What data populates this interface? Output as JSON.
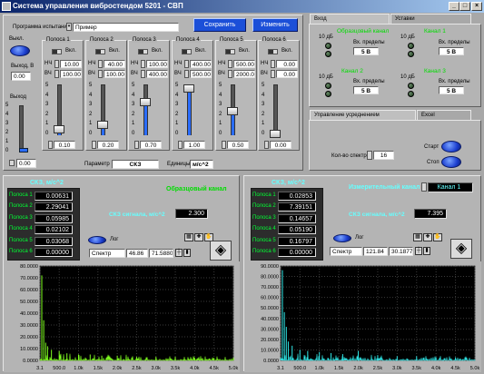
{
  "window": {
    "title": "Система управления вибростендом 5201 - СВП",
    "min": "_",
    "max": "□",
    "close": "×"
  },
  "top": {
    "program_label": "Программа испытаний",
    "program_value": "Пример",
    "save_label": "Сохранить",
    "change_label": "Изменить",
    "power_label": "Выкл.",
    "output_v_label": "Выход, В",
    "output_v_value": "0.00",
    "output_label": "Выход",
    "output_value": "0.00",
    "output_scale": [
      "5",
      "4",
      "3",
      "2",
      "1",
      "0"
    ],
    "param_label": "Параметр",
    "param_value": "СКЗ",
    "units_label": "Единицы",
    "units_value": "м/с^2"
  },
  "bands": [
    {
      "title": "Полоса 1",
      "toggle_label": "Вкл.",
      "hf_label": "НЧ",
      "hf_value": "10.00",
      "lf_label": "ВЧ",
      "lf_value": "100.00",
      "value": "0.10",
      "level": 0.1
    },
    {
      "title": "Полоса 2",
      "toggle_label": "Вкл.",
      "hf_label": "НЧ",
      "hf_value": "40.00",
      "lf_label": "ВЧ",
      "lf_value": "100.00",
      "value": "0.20",
      "level": 0.2
    },
    {
      "title": "Полоса 3",
      "toggle_label": "Вкл.",
      "hf_label": "НЧ",
      "hf_value": "100.00",
      "lf_label": "ВЧ",
      "lf_value": "400.00",
      "value": "0.70",
      "level": 0.7
    },
    {
      "title": "Полоса 4",
      "toggle_label": "Вкл.",
      "hf_label": "НЧ",
      "hf_value": "400.00",
      "lf_label": "ВЧ",
      "lf_value": "500.00",
      "value": "1.00",
      "level": 1.0
    },
    {
      "title": "Полоса 5",
      "toggle_label": "Вкл.",
      "hf_label": "НЧ",
      "hf_value": "500.00",
      "lf_label": "ВЧ",
      "lf_value": "2000.00",
      "value": "0.50",
      "level": 0.5
    },
    {
      "title": "Полоса 6",
      "toggle_label": "Вкл.",
      "hf_label": "НЧ",
      "hf_value": "0.00",
      "lf_label": "ВЧ",
      "lf_value": "0.00",
      "value": "0.00",
      "level": 0.0
    }
  ],
  "band_scale": [
    "5",
    "4",
    "3",
    "2",
    "1",
    "0"
  ],
  "inputs_panel": {
    "tabs": [
      "Вход",
      "Уставки"
    ],
    "reference_channel": "Образцовый канал",
    "channels": [
      {
        "title": "Канал 1",
        "db_label": "10 дБ",
        "range_label": "Вх. пределы",
        "range_value": "5 В"
      },
      {
        "title": "Канал 2",
        "db_label": "10 дБ",
        "range_label": "Вх. пределы",
        "range_value": "5 В"
      },
      {
        "title": "Канал 3",
        "db_label": "10 дБ",
        "range_label": "Вх. пределы",
        "range_value": "5 В"
      }
    ],
    "ref_db_label": "10 дБ",
    "ref_range_label": "Вх. пределы",
    "ref_range_value": "5 В"
  },
  "averaging": {
    "tabs": [
      "Управление усреднением",
      "Excel"
    ],
    "spectra_label": "Кол-во спектров",
    "spectra_value": "16",
    "start_label": "Старт",
    "stop_label": "Стоп"
  },
  "left_channel": {
    "header": "СКЗ, м/с^2",
    "title": "Образцовый канал",
    "band_labels": [
      "Полоса 1",
      "Полоса 2",
      "Полоса 3",
      "Полоса 4",
      "Полоса 5",
      "Полоса 6"
    ],
    "band_values": [
      "0.00631",
      "2.29041",
      "0.05985",
      "0.02102",
      "0.03068",
      "0.00000"
    ],
    "sum_label": "СКЗ сигнала, м/с^2",
    "sum_value": "2.300",
    "log_label": "Лог",
    "cursor_name": "Спектр",
    "cursor_x": "46.86",
    "cursor_y": "71.5880"
  },
  "right_channel": {
    "header": "СКЗ, м/с^2",
    "title": "Измерительный канал",
    "channel_select": "Канал 1",
    "band_labels": [
      "Полоса 1",
      "Полоса 2",
      "Полоса 3",
      "Полоса 4",
      "Полоса 5",
      "Полоса 6"
    ],
    "band_values": [
      "0.02853",
      "7.39151",
      "0.14657",
      "0.05190",
      "0.16797",
      "0.00000"
    ],
    "sum_label": "СКЗ сигнала, м/с^2",
    "sum_value": "7.395",
    "log_label": "Лог",
    "cursor_name": "Спектр",
    "cursor_x": "121.84",
    "cursor_y": "30.1877"
  },
  "chart_data": [
    {
      "type": "line",
      "title": "",
      "color": "#80ff20",
      "x_ticks": [
        "3.1",
        "500.0",
        "1.0k",
        "1.5k",
        "2.0k",
        "2.5k",
        "3.0k",
        "3.5k",
        "4.0k",
        "4.5k",
        "5.0k"
      ],
      "y_ticks": [
        "80.0000",
        "70.0000",
        "60.0000",
        "50.0000",
        "40.0000",
        "30.0000",
        "20.0000",
        "10.0000",
        "0.0000"
      ],
      "xlim": [
        3.1,
        5000
      ],
      "ylim": [
        0,
        80
      ],
      "grid": true,
      "peaks": [
        [
          50,
          72
        ],
        [
          100,
          34
        ],
        [
          150,
          15
        ],
        [
          200,
          12
        ],
        [
          300,
          9
        ],
        [
          500,
          8
        ],
        [
          700,
          6
        ],
        [
          1000,
          5
        ],
        [
          1300,
          5
        ],
        [
          1600,
          4
        ],
        [
          2000,
          4
        ],
        [
          2500,
          3
        ],
        [
          3000,
          3
        ],
        [
          3500,
          3
        ],
        [
          4000,
          2
        ],
        [
          4500,
          2
        ]
      ]
    },
    {
      "type": "line",
      "title": "",
      "color": "#30e8e8",
      "x_ticks": [
        "3.1",
        "500.0",
        "1.0k",
        "1.5k",
        "2.0k",
        "2.5k",
        "3.0k",
        "3.5k",
        "4.0k",
        "4.5k",
        "5.0k"
      ],
      "y_ticks": [
        "90.0000",
        "80.0000",
        "70.0000",
        "60.0000",
        "50.0000",
        "40.0000",
        "30.0000",
        "20.0000",
        "10.0000",
        "0.0000"
      ],
      "xlim": [
        3.1,
        5000
      ],
      "ylim": [
        0,
        90
      ],
      "grid": true,
      "peaks": [
        [
          50,
          86
        ],
        [
          100,
          46
        ],
        [
          150,
          32
        ],
        [
          200,
          18
        ],
        [
          300,
          14
        ],
        [
          500,
          10
        ],
        [
          700,
          9
        ],
        [
          1000,
          8
        ],
        [
          1300,
          7
        ],
        [
          1600,
          6
        ],
        [
          2000,
          9
        ],
        [
          2500,
          5
        ],
        [
          3000,
          4
        ],
        [
          3500,
          4
        ],
        [
          4000,
          3
        ],
        [
          4500,
          3
        ]
      ]
    }
  ]
}
